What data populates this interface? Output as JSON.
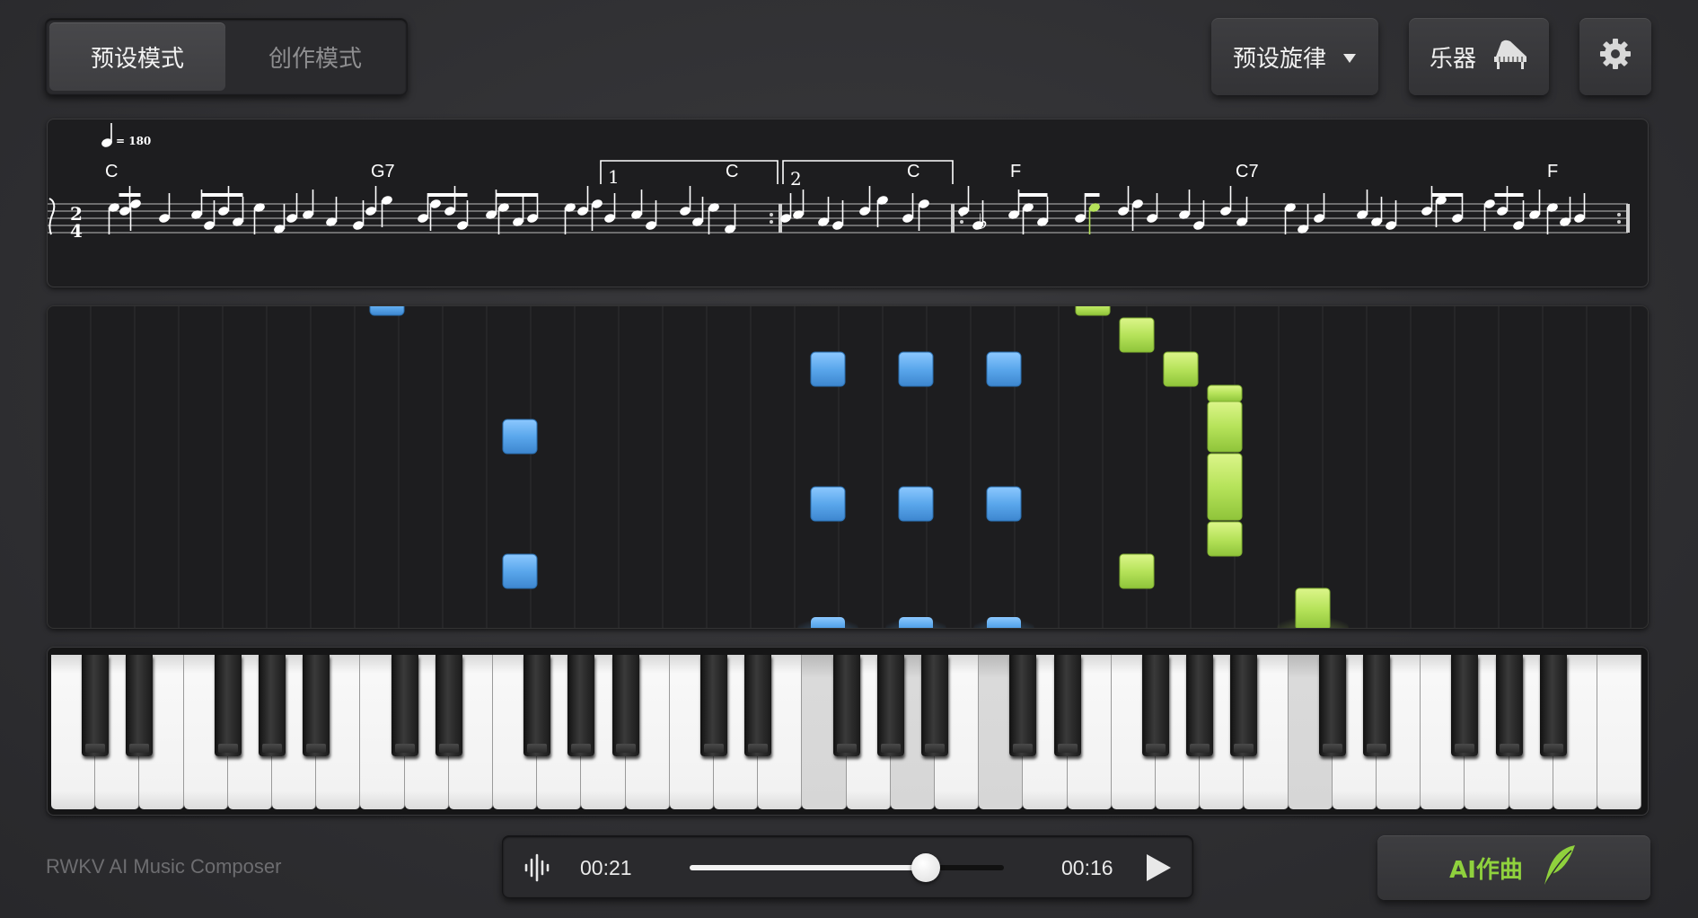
{
  "modes": {
    "preset": "预设模式",
    "create": "创作模式",
    "active": "preset"
  },
  "toolbar": {
    "melody_label": "预设旋律",
    "instrument_label": "乐器",
    "dropdown_icon": "triangle-down-icon",
    "instrument_icon": "grand-piano-icon",
    "settings_icon": "gear-icon"
  },
  "score": {
    "tempo": "= 180",
    "time_signature_top": "2",
    "time_signature_bottom": "4",
    "chords": [
      "C",
      "G7",
      "C",
      "C",
      "F",
      "C7",
      "F"
    ],
    "volta": [
      "1",
      "2"
    ],
    "flat_symbol": "♭"
  },
  "piano_roll": {
    "colors": {
      "blue": "#5aa7ec",
      "green": "#b6e35a"
    }
  },
  "player": {
    "current_time": "00:21",
    "remaining_time": "00:16",
    "progress": 0.75,
    "waveform_icon": "waveform-icon",
    "play_icon": "play-icon"
  },
  "footer": {
    "brand": "RWKV AI Music Composer",
    "ai_button_label": "AI作曲",
    "ai_icon": "feather-quill-icon"
  }
}
